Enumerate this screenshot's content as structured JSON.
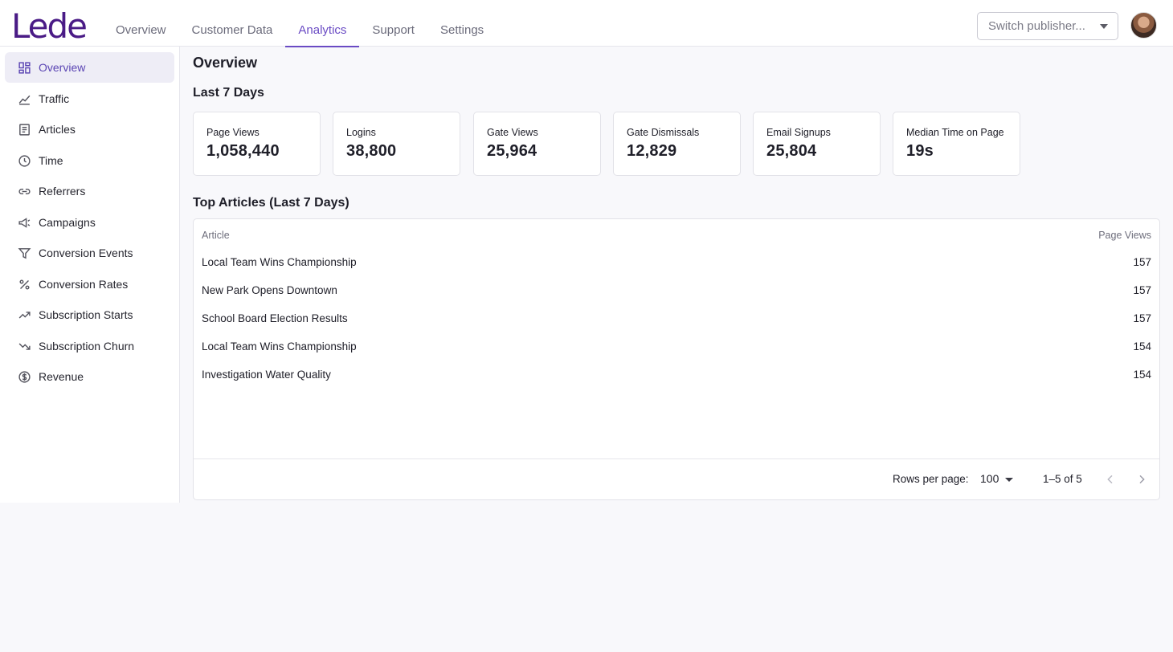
{
  "brand": {
    "logo_text": "Lede",
    "color": "#4a1b86",
    "accent": "#6a4bc4"
  },
  "topnav": {
    "tabs": [
      {
        "label": "Overview",
        "active": false
      },
      {
        "label": "Customer Data",
        "active": false
      },
      {
        "label": "Analytics",
        "active": true
      },
      {
        "label": "Support",
        "active": false
      },
      {
        "label": "Settings",
        "active": false
      }
    ],
    "publisher_placeholder": "Switch publisher...",
    "avatar_icon": "user-avatar"
  },
  "sidebar": {
    "items": [
      {
        "label": "Overview",
        "icon": "dashboard-icon",
        "active": true
      },
      {
        "label": "Traffic",
        "icon": "line-chart-icon",
        "active": false
      },
      {
        "label": "Articles",
        "icon": "article-icon",
        "active": false
      },
      {
        "label": "Time",
        "icon": "clock-icon",
        "active": false
      },
      {
        "label": "Referrers",
        "icon": "link-icon",
        "active": false
      },
      {
        "label": "Campaigns",
        "icon": "megaphone-icon",
        "active": false
      },
      {
        "label": "Conversion Events",
        "icon": "filter-icon",
        "active": false
      },
      {
        "label": "Conversion Rates",
        "icon": "percent-icon",
        "active": false
      },
      {
        "label": "Subscription Starts",
        "icon": "trending-up-icon",
        "active": false
      },
      {
        "label": "Subscription Churn",
        "icon": "trending-down-icon",
        "active": false
      },
      {
        "label": "Revenue",
        "icon": "dollar-icon",
        "active": false
      }
    ]
  },
  "main": {
    "title": "Overview",
    "period_title": "Last 7 Days",
    "metrics": [
      {
        "label": "Page Views",
        "value": "1,058,440"
      },
      {
        "label": "Logins",
        "value": "38,800"
      },
      {
        "label": "Gate Views",
        "value": "25,964"
      },
      {
        "label": "Gate Dismissals",
        "value": "12,829"
      },
      {
        "label": "Email Signups",
        "value": "25,804"
      },
      {
        "label": "Median Time on Page",
        "value": "19s"
      }
    ],
    "top_articles_title": "Top Articles (Last 7 Days)",
    "table": {
      "columns": [
        "Article",
        "Page Views"
      ],
      "rows": [
        {
          "article": "Local Team Wins Championship",
          "views": "157"
        },
        {
          "article": "New Park Opens Downtown",
          "views": "157"
        },
        {
          "article": "School Board Election Results",
          "views": "157"
        },
        {
          "article": "Local Team Wins Championship",
          "views": "154"
        },
        {
          "article": "Investigation Water Quality",
          "views": "154"
        }
      ],
      "footer": {
        "rows_per_page_label": "Rows per page:",
        "rows_per_page_value": "100",
        "range": "1–5 of 5"
      }
    }
  }
}
